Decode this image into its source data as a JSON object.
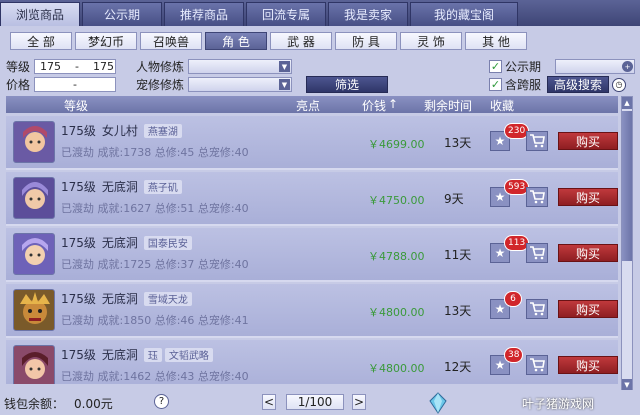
{
  "tabs": [
    {
      "label": "浏览商品",
      "active": true
    },
    {
      "label": "公示期",
      "active": false
    },
    {
      "label": "推荐商品",
      "active": false
    },
    {
      "label": "回流专属",
      "active": false
    },
    {
      "label": "我是卖家",
      "active": false
    },
    {
      "label": "我的藏宝阁",
      "active": false
    }
  ],
  "categories": [
    "全 部",
    "梦幻币",
    "召唤兽",
    "角 色",
    "武 器",
    "防 具",
    "灵 饰",
    "其 他"
  ],
  "active_category": "角 色",
  "filters": {
    "level_label": "等级",
    "level_min": "175",
    "level_sep": "-",
    "level_max": "175",
    "price_label": "价格",
    "price_sep": "-",
    "char_cultivation_label": "人物修炼",
    "pet_cultivation_label": "宠修修炼",
    "filter_button": "筛选",
    "public_period_label": "公示期",
    "cross_server_label": "含跨服",
    "advanced_search_button": "高级搜索",
    "colors": {
      "check": "#2e9a3a"
    }
  },
  "table": {
    "headers": {
      "level": "等级",
      "highlights": "亮点",
      "price": "价钱",
      "price_sort_arrow": "↑",
      "remaining": "剩余时间",
      "favorites": "收藏"
    },
    "rows": [
      {
        "level": "175级",
        "school": "女儿村",
        "tags": [
          "燕塞湖"
        ],
        "l2": "已渡劫 成就:1738 总修:45 总宠修:40",
        "price": "￥4699.00",
        "remaining": "13天",
        "fav_count": "230",
        "buy": "购买",
        "avatar_color": "#b04a6a"
      },
      {
        "level": "175级",
        "school": "无底洞",
        "tags": [
          "燕子矶"
        ],
        "l2": "已渡劫 成就:1627 总修:51 总宠修:40",
        "price": "￥4750.00",
        "remaining": "9天",
        "fav_count": "593",
        "buy": "购买",
        "avatar_color": "#7a6ac4"
      },
      {
        "level": "175级",
        "school": "无底洞",
        "tags": [
          "国泰民安"
        ],
        "l2": "已渡劫 成就:1725 总修:37 总宠修:40",
        "price": "￥4788.00",
        "remaining": "11天",
        "fav_count": "113",
        "buy": "购买",
        "avatar_color": "#8a7ed0"
      },
      {
        "level": "175级",
        "school": "无底洞",
        "tags": [
          "雪域天龙"
        ],
        "l2": "已渡劫 成就:1850 总修:46 总宠修:41",
        "price": "￥4800.00",
        "remaining": "13天",
        "fav_count": "6",
        "buy": "购买",
        "avatar_color": "#a06a2a"
      },
      {
        "level": "175级",
        "school": "无底洞",
        "tags": [
          "珏",
          "文韬武略"
        ],
        "l2": "已渡劫 成就:1462 总修:43 总宠修:40",
        "price": "￥4800.00",
        "remaining": "12天",
        "fav_count": "38",
        "buy": "购买",
        "avatar_color": "#b04a5a"
      }
    ]
  },
  "bottom": {
    "wallet_label": "钱包余额：",
    "wallet_value": "0.00元",
    "help": "?",
    "prev": "<",
    "page": "1/100",
    "next": ">",
    "watermark": "叶子猪游戏网"
  }
}
